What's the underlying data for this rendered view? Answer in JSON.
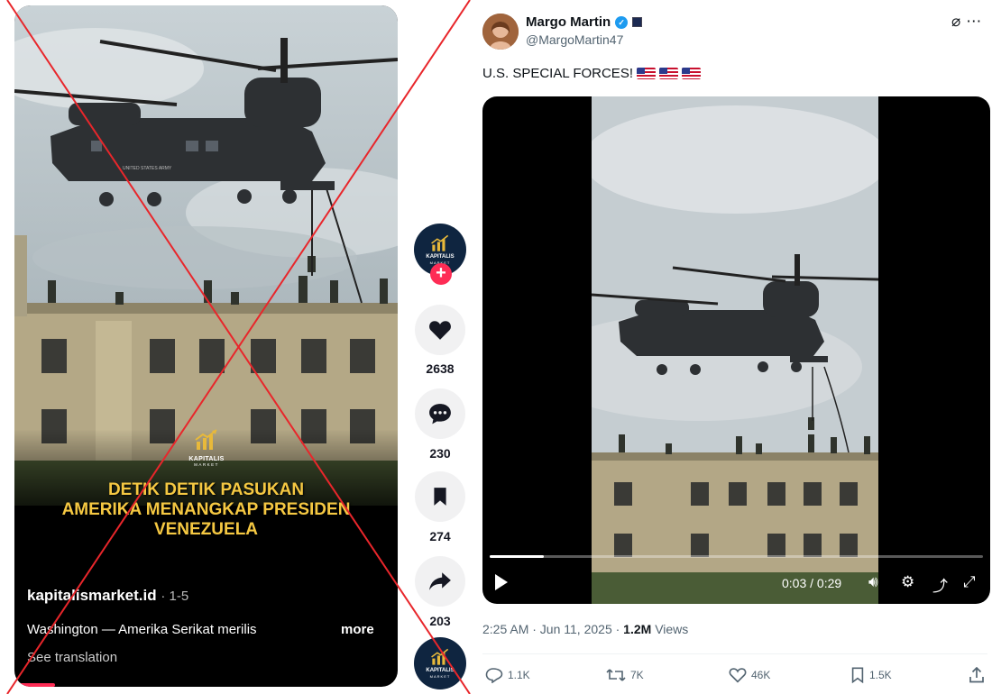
{
  "tiktok": {
    "brand_name": "KAPITALIS",
    "brand_sub": "MARKET",
    "helicopter_text": "UNITED STATES ARMY",
    "headline": [
      "DETIK DETIK PASUKAN",
      "AMERIKA MENANGKAP PRESIDEN",
      "VENEZUELA"
    ],
    "username": "kapitalismarket.id",
    "part": "· 1-5",
    "description": "Washington — Amerika Serikat merilis",
    "more": "more",
    "see_translation": "See translation",
    "accent_color": "#fe2c55",
    "headline_color": "#f5c842"
  },
  "rail": {
    "avatar_name": "KAPITALIS",
    "avatar_sub": "MARKET",
    "follow": "+",
    "like_count": "2638",
    "comment_count": "230",
    "bookmark_count": "274",
    "share_count": "203",
    "icons": [
      "heart-icon",
      "comment-icon",
      "bookmark-icon",
      "share-icon"
    ]
  },
  "post": {
    "display_name": "Margo Martin",
    "handle": "@MargoMartin47",
    "text": "U.S. SPECIAL FORCES!",
    "video_time": "0:03 / 0:29",
    "video_progress": 0.11,
    "timestamp": "2:25 AM · Jun 11, 2025 ·",
    "views": "1.2M",
    "views_label": "Views",
    "replies": "1.1K",
    "reposts": "7K",
    "likes": "46K",
    "bookmarks": "1.5K",
    "verified_color": "#1d9bf0"
  },
  "overlay": {
    "cross_color": "#e8262b"
  }
}
